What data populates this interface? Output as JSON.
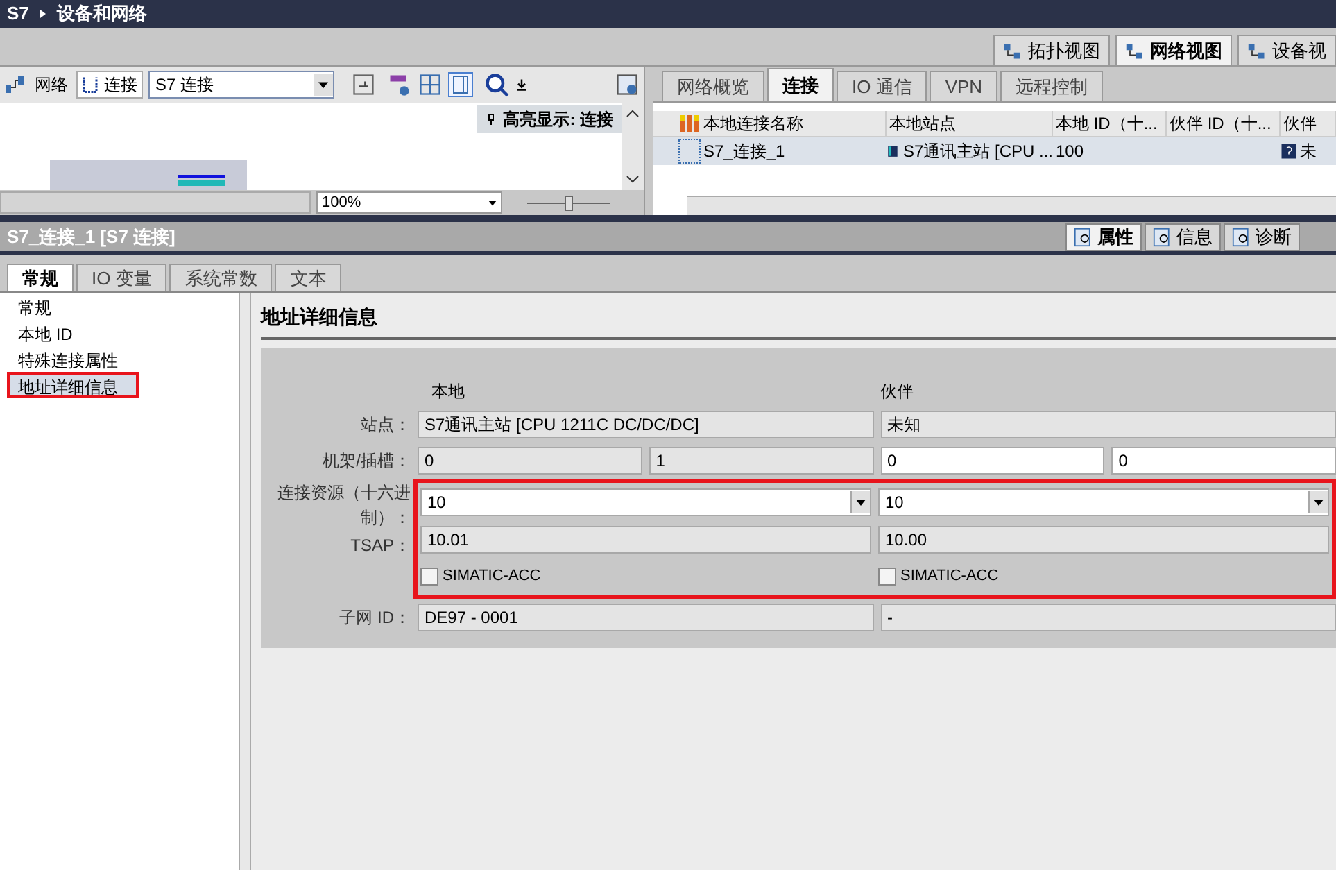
{
  "title": {
    "path": [
      "S7",
      "设备和网络"
    ]
  },
  "view_tabs": [
    {
      "label": "拓扑视图",
      "selected": false
    },
    {
      "label": "网络视图",
      "selected": true
    },
    {
      "label": "设备视",
      "selected": false
    }
  ],
  "network_toolbar": {
    "network_label": "网络",
    "connection_label": "连接",
    "connection_type": "S7 连接",
    "highlight": "高亮显示: 连接",
    "zoom": "100%",
    "zoom_slider": {
      "level": 0.5
    }
  },
  "editor_tabs": [
    {
      "label": "网络概览",
      "selected": false
    },
    {
      "label": "连接",
      "selected": true
    },
    {
      "label": "IO 通信",
      "selected": false
    },
    {
      "label": "VPN",
      "selected": false
    },
    {
      "label": "远程控制",
      "selected": false
    }
  ],
  "connections_table": {
    "columns": [
      "本地连接名称",
      "本地站点",
      "本地 ID（十...",
      "伙伴 ID（十...",
      "伙伴"
    ],
    "rows": [
      {
        "name": "S7_连接_1",
        "station": "S7通讯主站 [CPU ...",
        "local_id": "100",
        "partner": "未"
      }
    ]
  },
  "inspector": {
    "title": "S7_连接_1 [S7 连接]",
    "tabs": [
      {
        "label": "属性",
        "selected": true
      },
      {
        "label": "信息",
        "selected": false
      },
      {
        "label": "诊断",
        "selected": false
      }
    ],
    "sub_tabs": [
      {
        "label": "常规",
        "selected": true
      },
      {
        "label": "IO 变量",
        "selected": false
      },
      {
        "label": "系统常数",
        "selected": false
      },
      {
        "label": "文本",
        "selected": false
      }
    ],
    "nav": [
      {
        "label": "常规",
        "selected": false,
        "annotated": false
      },
      {
        "label": "本地 ID",
        "selected": false,
        "annotated": false
      },
      {
        "label": "特殊连接属性",
        "selected": false,
        "annotated": false
      },
      {
        "label": "地址详细信息",
        "selected": true,
        "annotated": true
      }
    ],
    "section": {
      "heading": "地址详细信息",
      "local_header": "本地",
      "partner_header": "伙伴",
      "rows": [
        {
          "kind": "fields",
          "label": "站点：",
          "annotated": false,
          "local": [
            {
              "value": "S7通讯主站 [CPU 1211C DC/DC/DC]",
              "editable": false
            }
          ],
          "partner": [
            {
              "value": "未知",
              "editable": false
            }
          ]
        },
        {
          "kind": "fields",
          "label": "机架/插槽：",
          "annotated": false,
          "local": [
            {
              "value": "0",
              "editable": false
            },
            {
              "value": "1",
              "editable": false
            }
          ],
          "partner": [
            {
              "value": "0",
              "editable": true
            },
            {
              "value": "0",
              "editable": true
            }
          ]
        },
        {
          "kind": "dropdown",
          "label": "连接资源（十六进制）：",
          "annotated": true,
          "local": "10",
          "partner": "10"
        },
        {
          "kind": "fields",
          "label": "TSAP：",
          "annotated": true,
          "local": [
            {
              "value": "10.01",
              "editable": false
            }
          ],
          "partner": [
            {
              "value": "10.00",
              "editable": false
            }
          ]
        },
        {
          "kind": "checkbox",
          "annotated": true,
          "local": {
            "label": "SIMATIC-ACC",
            "checked": false
          },
          "partner": {
            "label": "SIMATIC-ACC",
            "checked": false
          }
        },
        {
          "kind": "fields",
          "label": "子网 ID：",
          "annotated": false,
          "local": [
            {
              "value": "DE97 - 0001",
              "editable": false
            }
          ],
          "partner": [
            {
              "value": "-",
              "editable": false
            }
          ]
        }
      ]
    }
  }
}
